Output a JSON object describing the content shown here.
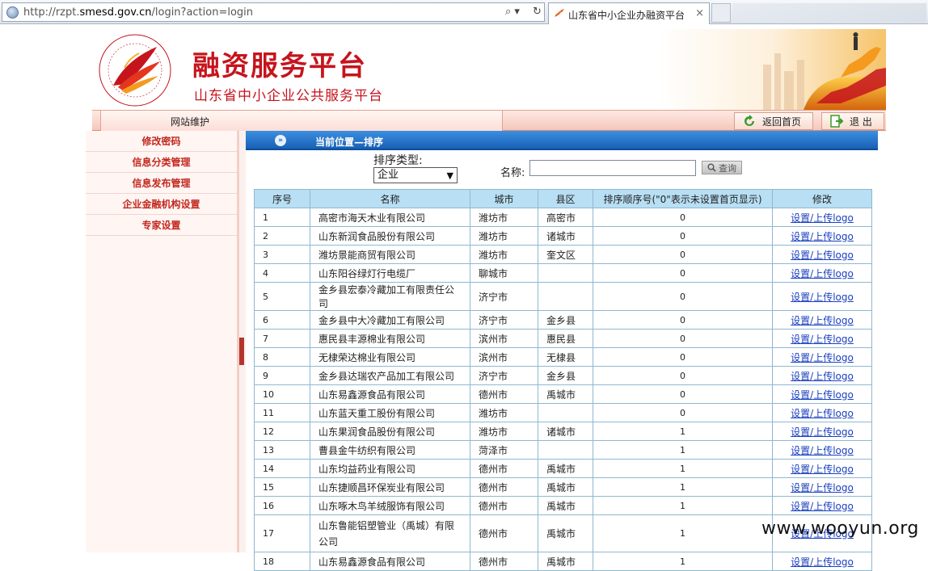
{
  "browser": {
    "url_prefix": "http://rzpt.",
    "url_domain": "smesd.gov.cn",
    "url_suffix": "/login?action=login",
    "search_glyph": "⌕ ▾",
    "refresh_glyph": "↻",
    "tab_title": "山东省中小企业办融资平台",
    "tab_close": "×"
  },
  "header": {
    "title": "融资服务平台",
    "subtitle": "山东省中小企业公共服务平台"
  },
  "navbar": {
    "site_tab": "网站维护",
    "home_button": "返回首页",
    "logout_button": "退 出"
  },
  "sidebar": {
    "items": [
      {
        "label": "修改密码"
      },
      {
        "label": "信息分类管理"
      },
      {
        "label": "信息发布管理"
      },
      {
        "label": "企业金融机构设置"
      },
      {
        "label": "专家设置"
      }
    ]
  },
  "location": {
    "text": "当前位置—排序"
  },
  "filters": {
    "sort_type_label": "排序类型:",
    "sort_type_value": "企业",
    "name_label": "名称:",
    "name_value": "",
    "query_button": "查询"
  },
  "table": {
    "headers": [
      "序号",
      "名称",
      "城市",
      "县区",
      "排序顺序号(\"0\"表示未设置首页显示)",
      "修改"
    ],
    "edit_link": "设置/上传logo",
    "rows": [
      {
        "no": "1",
        "name": "高密市海天木业有限公司",
        "city": "潍坊市",
        "county": "高密市",
        "order": "0"
      },
      {
        "no": "2",
        "name": "山东新润食品股份有限公司",
        "city": "潍坊市",
        "county": "诸城市",
        "order": "0"
      },
      {
        "no": "3",
        "name": "潍坊景能商贸有限公司",
        "city": "潍坊市",
        "county": "奎文区",
        "order": "0"
      },
      {
        "no": "4",
        "name": "山东阳谷绿灯行电缆厂",
        "city": "聊城市",
        "county": "",
        "order": "0"
      },
      {
        "no": "5",
        "name": "金乡县宏泰冷藏加工有限责任公司",
        "city": "济宁市",
        "county": "",
        "order": "0"
      },
      {
        "no": "6",
        "name": "金乡县中大冷藏加工有限公司",
        "city": "济宁市",
        "county": "金乡县",
        "order": "0"
      },
      {
        "no": "7",
        "name": "惠民县丰源棉业有限公司",
        "city": "滨州市",
        "county": "惠民县",
        "order": "0"
      },
      {
        "no": "8",
        "name": "无棣荣达棉业有限公司",
        "city": "滨州市",
        "county": "无棣县",
        "order": "0"
      },
      {
        "no": "9",
        "name": "金乡县达瑞农产品加工有限公司",
        "city": "济宁市",
        "county": "金乡县",
        "order": "0"
      },
      {
        "no": "10",
        "name": "山东易鑫源食品有限公司",
        "city": "德州市",
        "county": "禹城市",
        "order": "0"
      },
      {
        "no": "11",
        "name": "山东蓝天重工股份有限公司",
        "city": "潍坊市",
        "county": "",
        "order": "0"
      },
      {
        "no": "12",
        "name": "山东果润食品股份有限公司",
        "city": "潍坊市",
        "county": "诸城市",
        "order": "1"
      },
      {
        "no": "13",
        "name": "曹县金牛纺织有限公司",
        "city": "菏泽市",
        "county": "",
        "order": "1"
      },
      {
        "no": "14",
        "name": "山东均益药业有限公司",
        "city": "德州市",
        "county": "禹城市",
        "order": "1"
      },
      {
        "no": "15",
        "name": "山东捷顺昌环保炭业有限公司",
        "city": "德州市",
        "county": "禹城市",
        "order": "1"
      },
      {
        "no": "16",
        "name": "山东啄木鸟羊绒服饰有限公司",
        "city": "德州市",
        "county": "禹城市",
        "order": "1"
      },
      {
        "no": "17",
        "name": "山东鲁能铝塑管业（禹城）有限公司",
        "city": "德州市",
        "county": "禹城市",
        "order": "1"
      },
      {
        "no": "18",
        "name": "山东易鑫源食品有限公司",
        "city": "德州市",
        "county": "禹城市",
        "order": "1"
      }
    ]
  },
  "watermark": "www.wooyun.org",
  "colors": {
    "brand_red": "#c6141d",
    "location_bar": "#1860b5",
    "table_header": "#b8dff3",
    "link": "#1a3fc0"
  }
}
